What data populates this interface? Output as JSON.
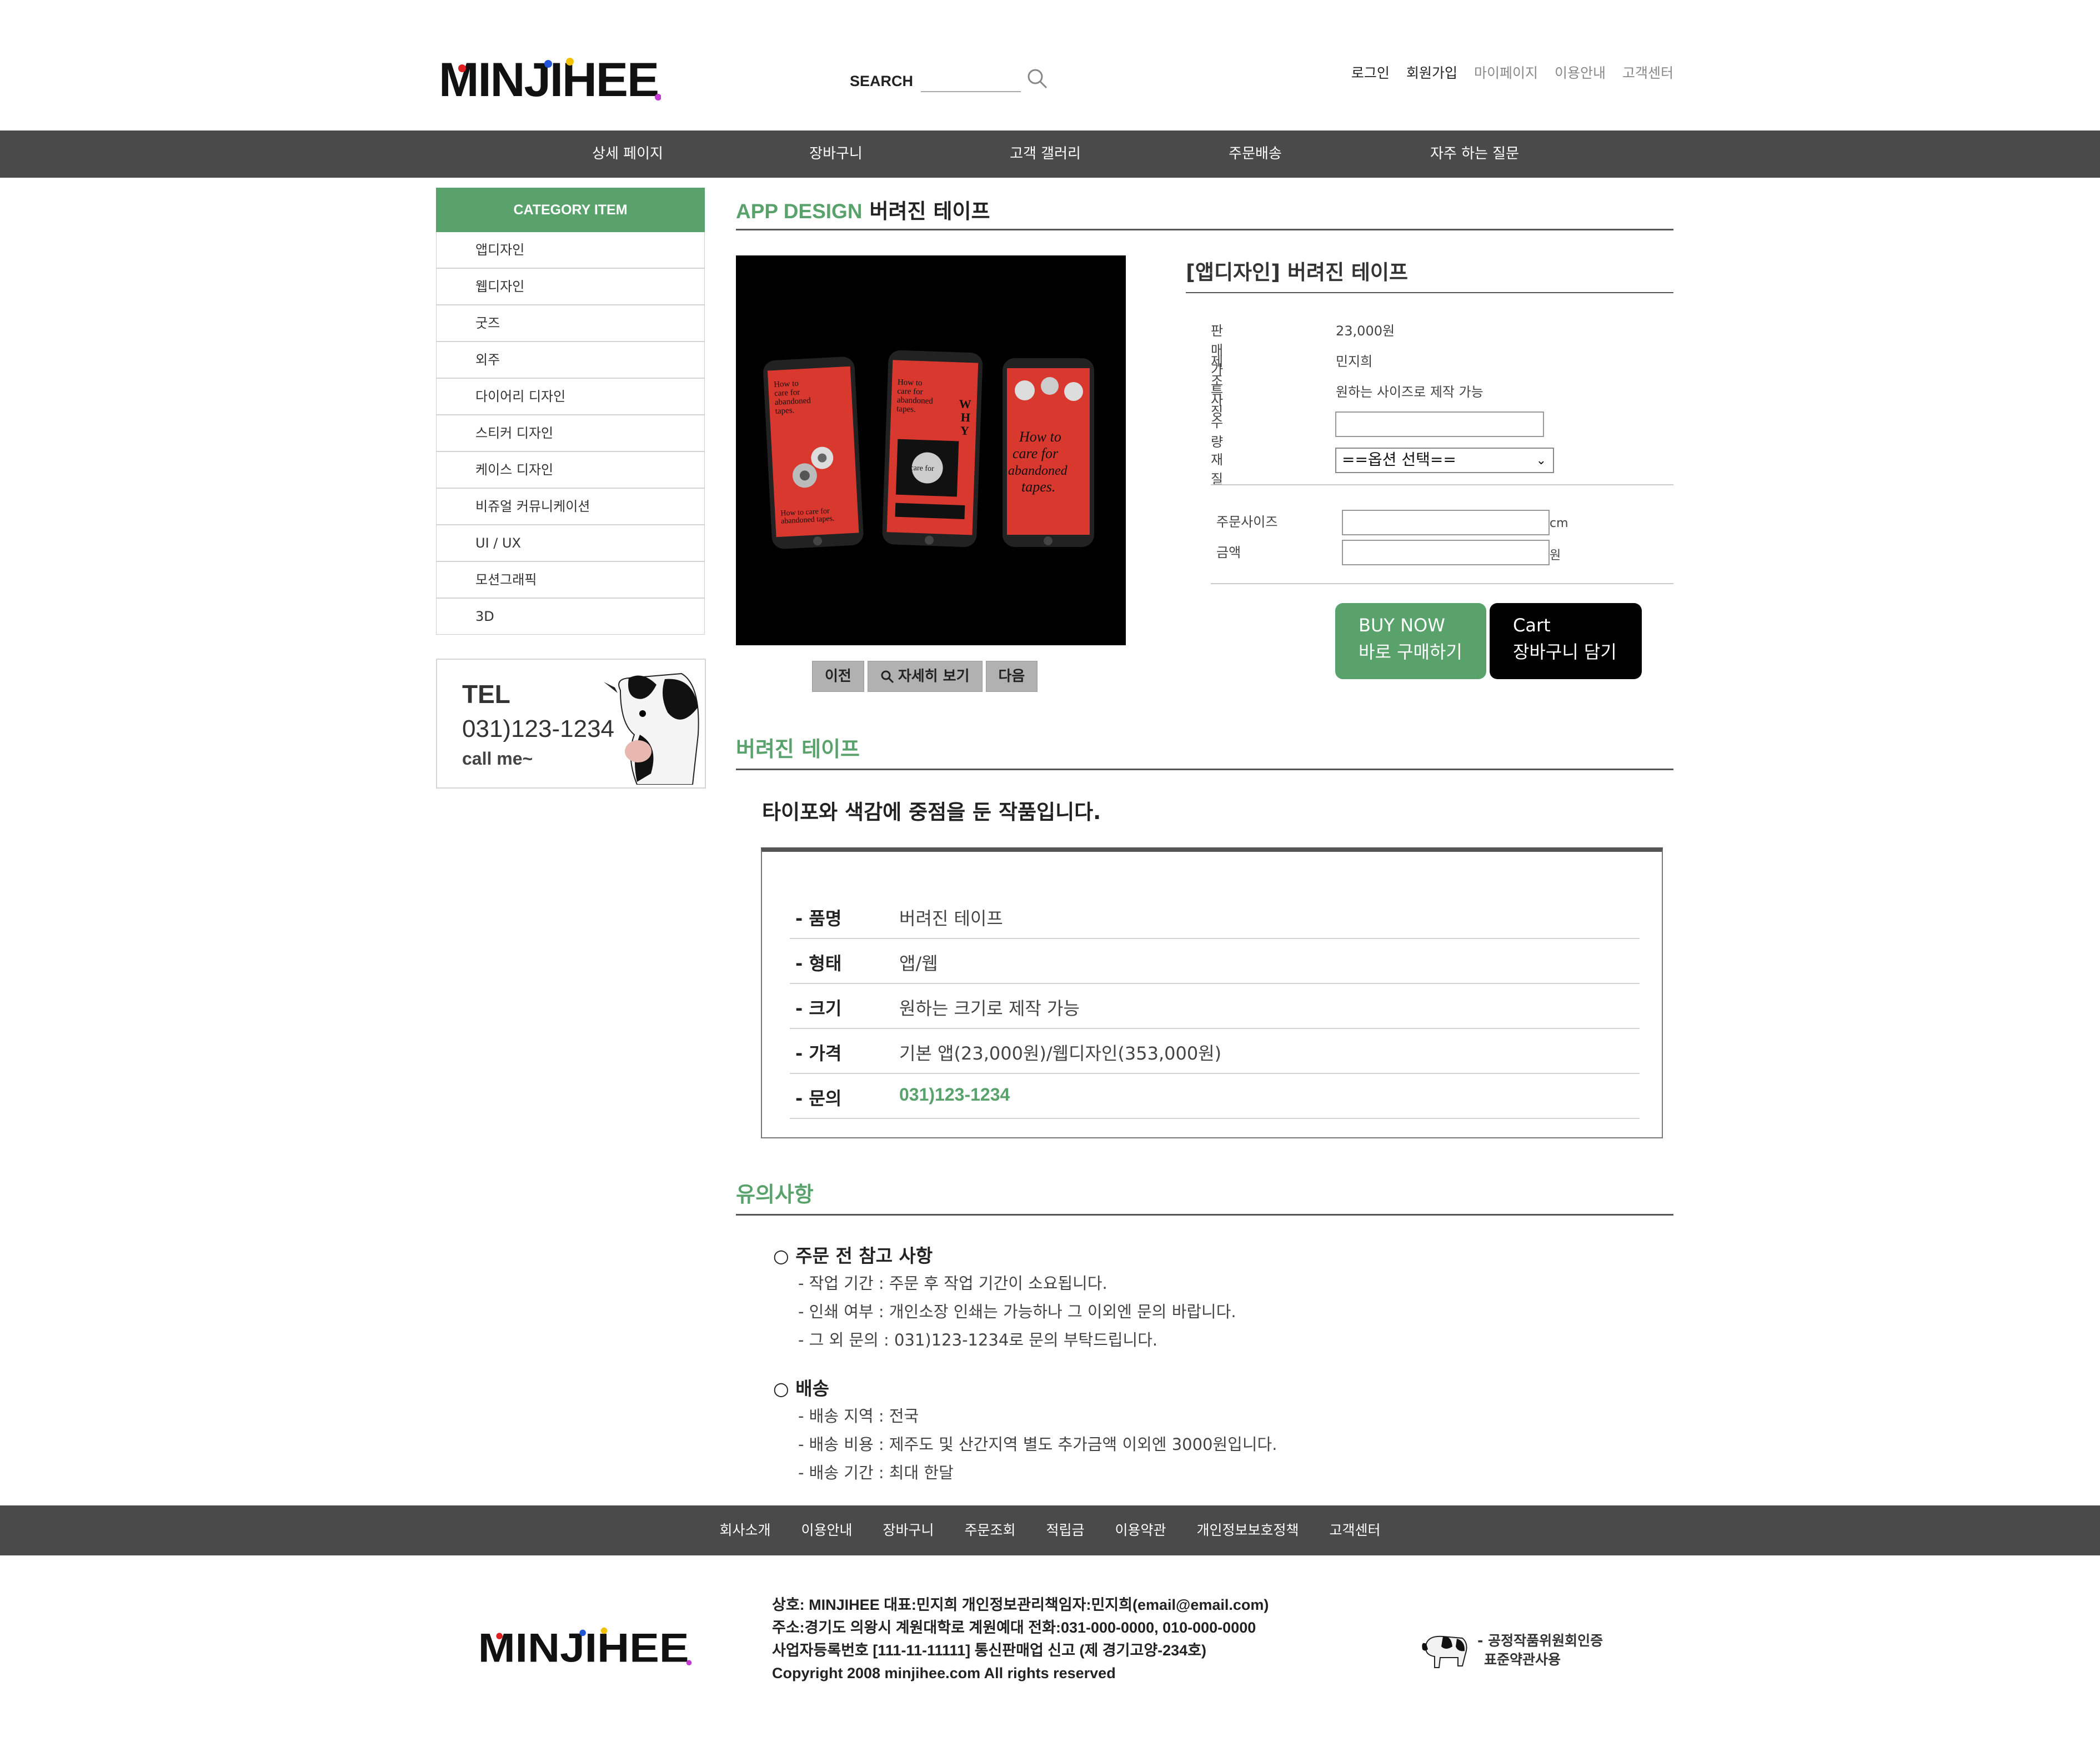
{
  "header": {
    "logo_text": "MINJIHEE",
    "search_label": "SEARCH",
    "top_links": [
      "로그인",
      "회원가입",
      "마이페이지",
      "이용안내",
      "고객센터"
    ]
  },
  "gnb": [
    "상세 페이지",
    "장바구니",
    "고객 갤러리",
    "주문배송",
    "자주 하는 질문"
  ],
  "sidebar": {
    "category_title": "CATEGORY ITEM",
    "categories": [
      "앱디자인",
      "웹디자인",
      "굿즈",
      "외주",
      "다이어리 디자인",
      "스티커 디자인",
      "케이스 디자인",
      "비쥬얼 커뮤니케이션",
      "UI / UX",
      "모션그래픽",
      "3D"
    ],
    "tel_label": "TEL",
    "tel_number": "031)123-1234",
    "tel_call": "call me~"
  },
  "product": {
    "title_accent": "APP DESIGN",
    "title_rest": "버려진 테이프",
    "name": "[앱디자인] 버려진 테이프",
    "specs": [
      {
        "label": "판매가",
        "value": "23,000원"
      },
      {
        "label": "제조사",
        "value": "민지희"
      },
      {
        "label": "특징",
        "value": "원하는 사이즈로 제작 가능"
      },
      {
        "label": "수량",
        "value": ""
      },
      {
        "label": "재질",
        "value": ""
      }
    ],
    "material_select": "==옵션 선택==",
    "order_size_label": "주문사이즈",
    "order_size_unit": "cm",
    "amount_label": "금액",
    "amount_unit": "원",
    "image_buttons": {
      "prev": "이전",
      "zoom": "자세히 보기",
      "next": "다음"
    },
    "buy_now_en": "BUY NOW",
    "buy_now_ko": "바로 구매하기",
    "cart_en": "Cart",
    "cart_ko": "장바구니 담기",
    "mockup_text_1": "How to care for abandoned tapes.",
    "mockup_text_2": "WHY",
    "mockup_text_3": "care for abandoned tapes"
  },
  "detail": {
    "section_title": "버려진 테이프",
    "lead": "타이포와 색감에 중점을 둔 작품입니다.",
    "rows": [
      {
        "label": "- 품명",
        "value": "버려진 테이프"
      },
      {
        "label": "- 형태",
        "value": "앱/웹"
      },
      {
        "label": "- 크기",
        "value": "원하는 크기로 제작 가능"
      },
      {
        "label": "- 가격",
        "value": "기본 앱(23,000원)/웹디자인(353,000원)"
      },
      {
        "label": "- 문의",
        "value": "031)123-1234"
      }
    ]
  },
  "notice": {
    "section_title": "유의사항",
    "order_head": "○ 주문 전 참고 사항",
    "order_lines": [
      "- 작업 기간 : 주문 후 작업 기간이 소요됩니다.",
      "- 인쇄 여부 : 개인소장 인쇄는 가능하나 그 이외엔 문의 바랍니다.",
      "- 그 외 문의 : 031)123-1234로 문의 부탁드립니다."
    ],
    "ship_head": "○ 배송",
    "ship_lines": [
      "- 배송 지역 : 전국",
      "- 배송 비용 : 제주도 및 산간지역 별도 추가금액 이외엔 3000원입니다.",
      "- 배송 기간 : 최대 한달"
    ]
  },
  "footer": {
    "links": [
      "회사소개",
      "이용안내",
      "장바구니",
      "주문조회",
      "적립금",
      "이용약관",
      "개인정보보호정책",
      "고객센터"
    ],
    "info_lines": [
      "상호: MINJIHEE 대표:민지희 개인정보관리책임자:민지희(email@email.com)",
      "주소:경기도 의왕시 계원대학로 계원예대 전화:031-000-0000, 010-000-0000",
      "사업자등록번호 [111-11-11111] 통신판매업 신고 (제 경기고양-234호)",
      "Copyright 2008 minjihee.com All rights reserved"
    ],
    "seal_line1": "- 공정작품위원회인증",
    "seal_line2": "표준약관사용"
  },
  "colors": {
    "accent": "#5aa26c",
    "nav_bg": "#4a4a4a",
    "mockup_red": "#d9382e"
  }
}
